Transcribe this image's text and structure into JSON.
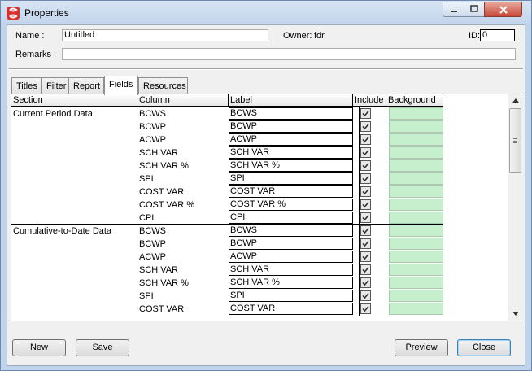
{
  "window": {
    "title": "Properties",
    "icon": "app-logo-icon"
  },
  "form": {
    "name_label": "Name :",
    "name_value": "Untitled",
    "owner_label": "Owner:",
    "owner_value": "fdr",
    "id_label": "ID:",
    "id_value": "0",
    "remarks_label": "Remarks :",
    "remarks_value": ""
  },
  "tabs": [
    {
      "label": "Titles"
    },
    {
      "label": "Filter"
    },
    {
      "label": "Report"
    },
    {
      "label": "Fields",
      "active": true
    },
    {
      "label": "Resources"
    }
  ],
  "grid": {
    "headers": {
      "section": "Section",
      "column": "Column",
      "label": "Label",
      "include": "Include",
      "background": "Background"
    },
    "background_color": "#c6efce",
    "rows": [
      {
        "section": "Current Period Data",
        "column": "BCWS",
        "label": "BCWS",
        "include": true
      },
      {
        "section": "",
        "column": "BCWP",
        "label": "BCWP",
        "include": true
      },
      {
        "section": "",
        "column": "ACWP",
        "label": "ACWP",
        "include": true
      },
      {
        "section": "",
        "column": "SCH VAR",
        "label": "SCH VAR",
        "include": true
      },
      {
        "section": "",
        "column": "SCH VAR %",
        "label": "SCH VAR %",
        "include": true
      },
      {
        "section": "",
        "column": "SPI",
        "label": "SPI",
        "include": true
      },
      {
        "section": "",
        "column": "COST VAR",
        "label": "COST VAR",
        "include": true
      },
      {
        "section": "",
        "column": "COST VAR %",
        "label": "COST VAR %",
        "include": true
      },
      {
        "section": "",
        "column": "CPI",
        "label": "CPI",
        "include": true
      },
      {
        "section": "Cumulative-to-Date Data",
        "column": "BCWS",
        "label": "BCWS",
        "include": true
      },
      {
        "section": "",
        "column": "BCWP",
        "label": "BCWP",
        "include": true
      },
      {
        "section": "",
        "column": "ACWP",
        "label": "ACWP",
        "include": true
      },
      {
        "section": "",
        "column": "SCH VAR",
        "label": "SCH VAR",
        "include": true
      },
      {
        "section": "",
        "column": "SCH VAR %",
        "label": "SCH VAR %",
        "include": true
      },
      {
        "section": "",
        "column": "SPI",
        "label": "SPI",
        "include": true
      },
      {
        "section": "",
        "column": "COST VAR",
        "label": "COST VAR",
        "include": true
      }
    ]
  },
  "buttons": {
    "new": "New",
    "save": "Save",
    "preview": "Preview",
    "close": "Close"
  }
}
